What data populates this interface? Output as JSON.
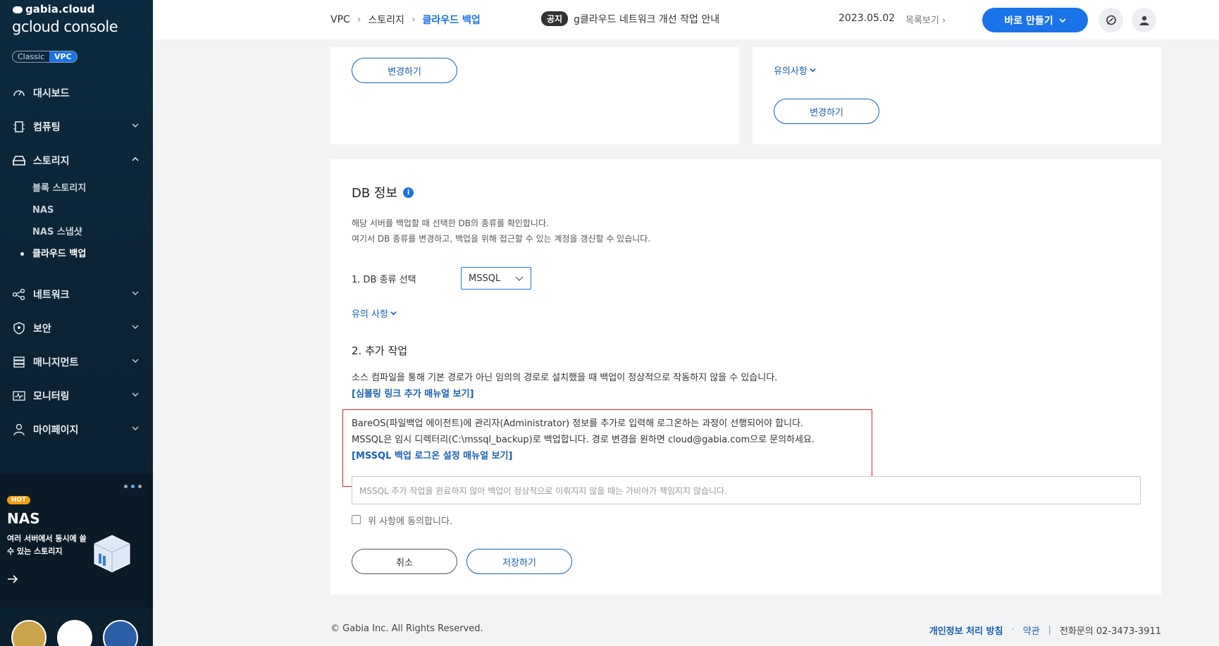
{
  "sidebar": {
    "brand": "gabia.cloud",
    "console_title": "gcloud console",
    "mode_classic": "Classic",
    "mode_vpc": "VPC",
    "items": [
      {
        "label": "대시보드",
        "icon": "dashboard-icon"
      },
      {
        "label": "컴퓨팅",
        "icon": "cpu-icon"
      },
      {
        "label": "스토리지",
        "icon": "storage-icon"
      },
      {
        "label": "네트워크",
        "icon": "network-icon"
      },
      {
        "label": "보안",
        "icon": "shield-icon"
      },
      {
        "label": "매니지먼트",
        "icon": "management-icon"
      },
      {
        "label": "모니터링",
        "icon": "monitoring-icon"
      },
      {
        "label": "마이페이지",
        "icon": "user-icon"
      }
    ],
    "storage_sub": [
      "블록 스토리지",
      "NAS",
      "NAS 스냅샷",
      "클라우드 백업"
    ],
    "promo": {
      "badge": "HOT",
      "title": "NAS",
      "text": "여러 서버에서 동시에 쓸 수 있는 스토리지"
    }
  },
  "header": {
    "breadcrumb": [
      "VPC",
      "스토리지",
      "클라우드 백업"
    ],
    "notice_tag": "공지",
    "notice_text": "g클라우드 네트워크 개선 작업 안내",
    "date": "2023.05.02",
    "more": "목록보기",
    "make_button": "바로 만들기"
  },
  "card1": {
    "change_button": "변경하기"
  },
  "card2": {
    "caution_link": "유의사항",
    "change_button": "변경하기"
  },
  "db": {
    "title": "DB 정보",
    "desc1": "해당 서버를 백업할 때 선택한 DB의 종류를 확인합니다.",
    "desc2": "여기서 DB 종류를 변경하고, 백업을 위해 접근할 수 있는 계정을 갱신할 수 있습니다.",
    "select_label": "1. DB 종류 선택",
    "select_value": "MSSQL",
    "caution_link": "유의 사항",
    "section2": "2. 추가 작업",
    "section2_text": "소스 컴파일을 통해 기본 경로가 아닌 임의의 경로로 설치했을 때 백업이 정상적으로 작동하지 않을 수 있습니다.",
    "symlink_link": "[심볼링 링크 추가 매뉴얼 보기]",
    "box_line1": "BareOS(파일백업 에이전트)에 관리자(Administrator) 정보를 추가로 입력해 로그온하는 과정이 선행되어야 합니다.",
    "box_line2": "MSSQL은 임시 디렉터리(C:\\mssql_backup)로 백업합니다. 경로 변경을 원하면 cloud@gabia.com으로 문의하세요.",
    "box_link": "[MSSQL 백업 로그온 설정 매뉴얼 보기]",
    "agree_placeholder": "MSSQL 추가 작업을 완료하지 않아 백업이 정상적으로 이뤄지지 않을 때는 가비아가 책임지지 않습니다.",
    "agree_label": "위 사항에 동의합니다.",
    "cancel_button": "취소",
    "save_button": "저장하기"
  },
  "footer": {
    "copyright": "© Gabia Inc. All Rights Reserved.",
    "privacy": "개인정보 처리 방침",
    "terms": "약관",
    "phone": "전화문의  02-3473-3911"
  },
  "colors": {
    "accent": "#1a73e8",
    "sidebar_bg": "#0b2a3f",
    "warning_border": "#d9262c"
  }
}
